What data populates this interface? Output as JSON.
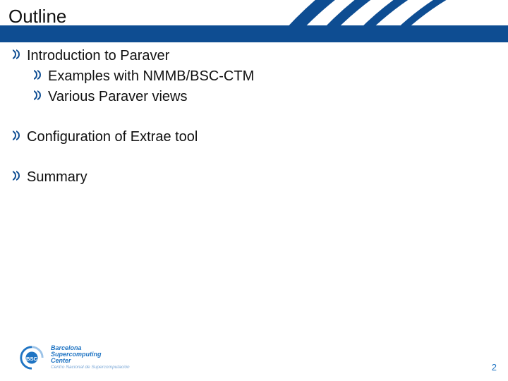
{
  "slide": {
    "title": "Outline",
    "items": {
      "i0": {
        "text": "Introduction to Paraver"
      },
      "i0_0": {
        "text": "Examples with NMMB/BSC-CTM"
      },
      "i0_1": {
        "text": "Various Paraver views"
      },
      "i1": {
        "text": "Configuration of Extrae tool"
      },
      "i2": {
        "text": "Summary"
      }
    },
    "page_number": "2"
  },
  "branding": {
    "acronym": "BSC",
    "name_line1": "Barcelona",
    "name_line2": "Supercomputing",
    "name_line3": "Center",
    "subtitle": "Centro Nacional de Supercomputación"
  },
  "colors": {
    "brand_blue": "#0e4d92",
    "brand_light": "#1f74c3"
  }
}
